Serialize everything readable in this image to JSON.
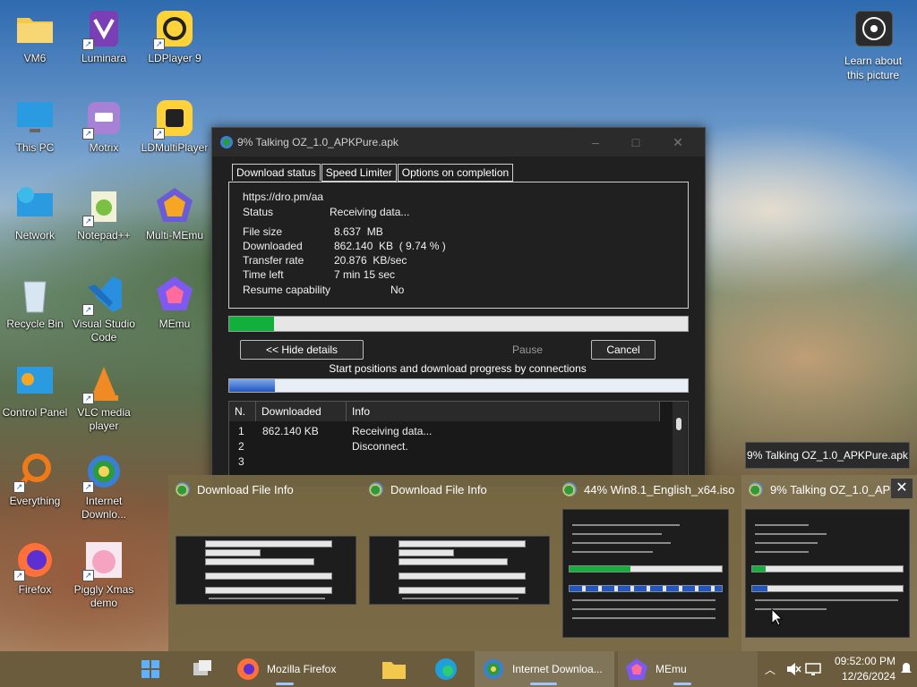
{
  "desktop": {
    "icons": [
      {
        "label": "VM6"
      },
      {
        "label": "Luminara"
      },
      {
        "label": "LDPlayer 9"
      },
      {
        "label": "This PC"
      },
      {
        "label": "Motrix"
      },
      {
        "label": "LDMultiPlayer"
      },
      {
        "label": "Network"
      },
      {
        "label": "Notepad++"
      },
      {
        "label": "Multi-MEmu"
      },
      {
        "label": "Recycle Bin"
      },
      {
        "label": "Visual Studio Code"
      },
      {
        "label": "MEmu"
      },
      {
        "label": "Control Panel"
      },
      {
        "label": "VLC media player"
      },
      {
        "label": "Everything"
      },
      {
        "label": "Internet Downlo..."
      },
      {
        "label": "Firefox"
      },
      {
        "label": "Piggly Xmas demo"
      }
    ],
    "learn_about": "Learn about this picture"
  },
  "download_window": {
    "title": "9% Talking OZ_1.0_APKPure.apk",
    "tabs": [
      "Download status",
      "Speed Limiter",
      "Options on completion"
    ],
    "url": "https://dro.pm/aa",
    "status_label": "Status",
    "status_value": "Receiving data...",
    "file_size_label": "File size",
    "file_size_value": "8.637  MB",
    "downloaded_label": "Downloaded",
    "downloaded_value": "862.140  KB  ( 9.74 % )",
    "transfer_rate_label": "Transfer rate",
    "transfer_rate_value": "20.876  KB/sec",
    "time_left_label": "Time left",
    "time_left_value": "7 min 15 sec",
    "resume_label": "Resume capability",
    "resume_value": "No",
    "progress_percent": 9.74,
    "hide_details_label": "<< Hide details",
    "pause_label": "Pause",
    "cancel_label": "Cancel",
    "connections_caption": "Start positions and download progress by connections",
    "connection_progress_fraction": 0.1,
    "table_headers": [
      "N.",
      "Downloaded",
      "Info"
    ],
    "table_rows": [
      {
        "n": "1",
        "downloaded": "862.140  KB",
        "info": "Receiving data..."
      },
      {
        "n": "2",
        "downloaded": "",
        "info": "Disconnect."
      },
      {
        "n": "3",
        "downloaded": "",
        "info": ""
      }
    ]
  },
  "thumbnails": [
    {
      "title": "Download File Info"
    },
    {
      "title": "Download File Info"
    },
    {
      "title": "44% Win8.1_English_x64.iso"
    },
    {
      "title": "9% Talking OZ_1.0_APK..."
    }
  ],
  "tooltip": "9% Talking OZ_1.0_APKPure.apk",
  "taskbar": {
    "firefox_label": "Mozilla Firefox",
    "idm_label": "Internet Downloa...",
    "memu_label": "MEmu",
    "time": "09:52:00 PM",
    "date": "12/26/2024"
  }
}
